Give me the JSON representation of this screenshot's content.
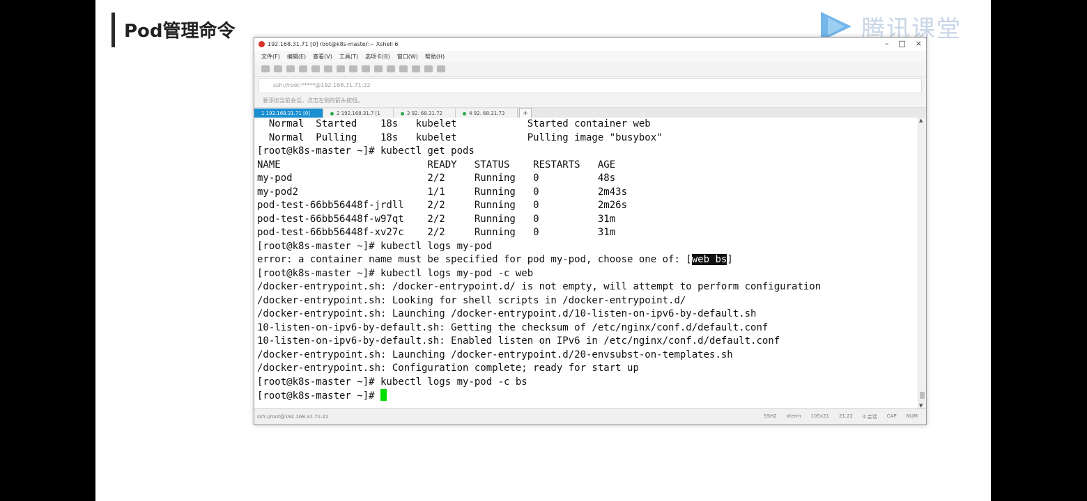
{
  "slide": {
    "title": "Pod管理命令",
    "logo_text": "腾讯课堂"
  },
  "window": {
    "title": "192.168.31.71 [0]   root@k8s-master:~   Xshell 6",
    "controls": [
      "–",
      "□",
      "×"
    ],
    "menu": [
      "文件(F)",
      "编辑(E)",
      "查看(V)",
      "工具(T)",
      "选项卡(B)",
      "窗口(W)",
      "帮助(H)"
    ],
    "address": "ssh://root:*****@192.168.31.71:22",
    "hint": "要添加当前会话，点击左侧的箭头按钮。",
    "tabs": [
      {
        "label": "1 192.168.31.71 [0]",
        "active": true
      },
      {
        "label": "2 192.168.31.7  [1",
        "active": false
      },
      {
        "label": "3  92.  68.31.72",
        "active": false
      },
      {
        "label": "4  92.  68.31.73",
        "active": false
      }
    ],
    "tab_add": "+"
  },
  "terminal": {
    "lines": [
      "  Normal  Started    18s   kubelet            Started container web",
      "  Normal  Pulling    18s   kubelet            Pulling image \"busybox\"",
      "[root@k8s-master ~]# kubectl get pods",
      "NAME                         READY   STATUS    RESTARTS   AGE",
      "my-pod                       2/2     Running   0          48s",
      "my-pod2                      1/1     Running   0          2m43s",
      "pod-test-66bb56448f-jrdll    2/2     Running   0          2m26s",
      "pod-test-66bb56448f-w97qt    2/2     Running   0          31m",
      "pod-test-66bb56448f-xv27c    2/2     Running   0          31m",
      "[root@k8s-master ~]# kubectl logs my-pod"
    ],
    "error_prefix": "error: a container name must be specified for pod my-pod, choose one of: [",
    "error_highlight": "web bs",
    "error_suffix": "]",
    "lines2": [
      "[root@k8s-master ~]# kubectl logs my-pod -c web",
      "/docker-entrypoint.sh: /docker-entrypoint.d/ is not empty, will attempt to perform configuration",
      "/docker-entrypoint.sh: Looking for shell scripts in /docker-entrypoint.d/",
      "/docker-entrypoint.sh: Launching /docker-entrypoint.d/10-listen-on-ipv6-by-default.sh",
      "10-listen-on-ipv6-by-default.sh: Getting the checksum of /etc/nginx/conf.d/default.conf",
      "10-listen-on-ipv6-by-default.sh: Enabled listen on IPv6 in /etc/nginx/conf.d/default.conf",
      "/docker-entrypoint.sh: Launching /docker-entrypoint.d/20-envsubst-on-templates.sh",
      "/docker-entrypoint.sh: Configuration complete; ready for start up",
      "[root@k8s-master ~]# kubectl logs my-pod -c bs"
    ],
    "prompt": "[root@k8s-master ~]# "
  },
  "statusbar": {
    "left": "ssh://root@192.168.31.71:22",
    "right": [
      "SSH2",
      "xterm",
      "105x21",
      "21,22",
      "4 会话",
      "CAP",
      "NUM"
    ]
  },
  "colors": {
    "tab_active": "#1a8fd1",
    "cursor": "#00e000",
    "logo_blue": "#5aa9e6"
  }
}
